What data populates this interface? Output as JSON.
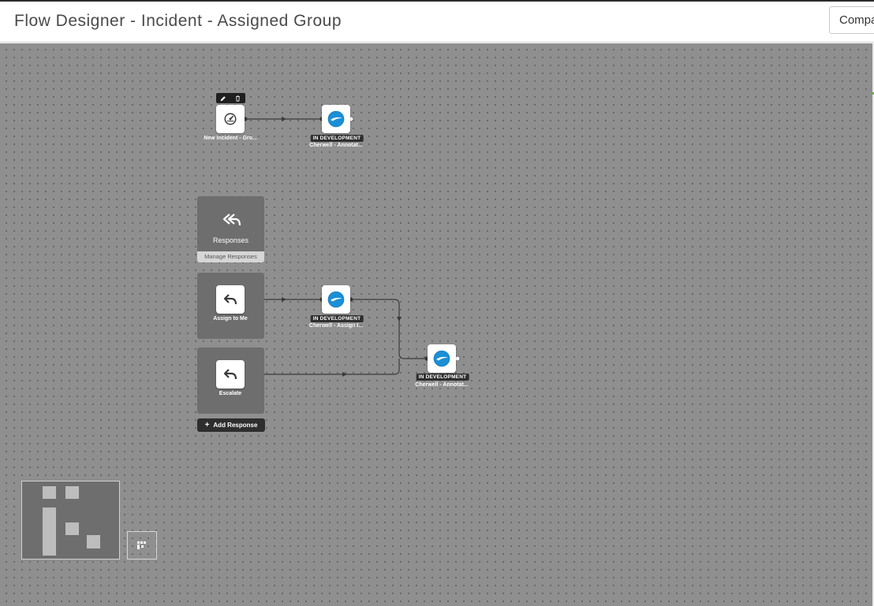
{
  "header": {
    "title": "Flow Designer - Incident - Assigned Group",
    "compare_label": "Compare"
  },
  "colors": {
    "canvas": "#8f8f8f",
    "panel": "#6e6e6e",
    "cherwell_blue": "#1a8fd6",
    "badge_bg": "#2e2e2e"
  },
  "trigger": {
    "label": "New Incident - Gro...",
    "icon": "speedometer-icon"
  },
  "trigger_toolbar": {
    "edit_icon": "pencil-icon",
    "delete_icon": "trash-icon"
  },
  "action_annotation_top": {
    "badge": "IN DEVELOPMENT",
    "label": "Cherwell - Annotat..."
  },
  "responses": {
    "title": "Responses",
    "manage_label": "Manage Responses",
    "icon": "reply-all-icon",
    "items": [
      {
        "label": "Assign to Me",
        "icon": "reply-icon"
      },
      {
        "label": "Escalate",
        "icon": "reply-icon"
      }
    ],
    "add_label": "Add Response"
  },
  "action_assign": {
    "badge": "IN DEVELOPMENT",
    "label": "Cherwell - Assign I..."
  },
  "action_annotation_bottom": {
    "badge": "IN DEVELOPMENT",
    "label": "Cherwell - Annotat..."
  },
  "minimap": {
    "toggle_icon": "minimap-icon"
  }
}
